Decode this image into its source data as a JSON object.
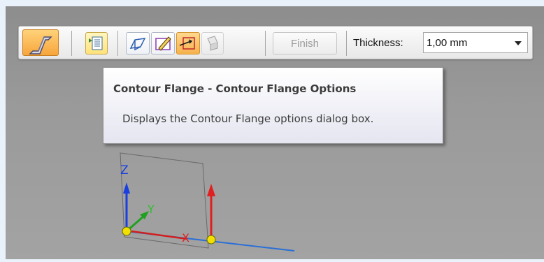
{
  "toolbar": {
    "finish_label": "Finish",
    "thickness_label": "Thickness:",
    "thickness_value": "1,00 mm"
  },
  "tooltip": {
    "title": "Contour Flange - Contour Flange Options",
    "description": "Displays the Contour Flange options dialog box."
  },
  "triad": {
    "z_label": "Z",
    "y_label": "Y",
    "x_label": "X"
  },
  "colors": {
    "active_orange": "#f7a53a",
    "x_axis": "#e02020",
    "y_axis": "#20a020",
    "z_axis": "#1a3ee0",
    "handle": "#f2e000"
  }
}
